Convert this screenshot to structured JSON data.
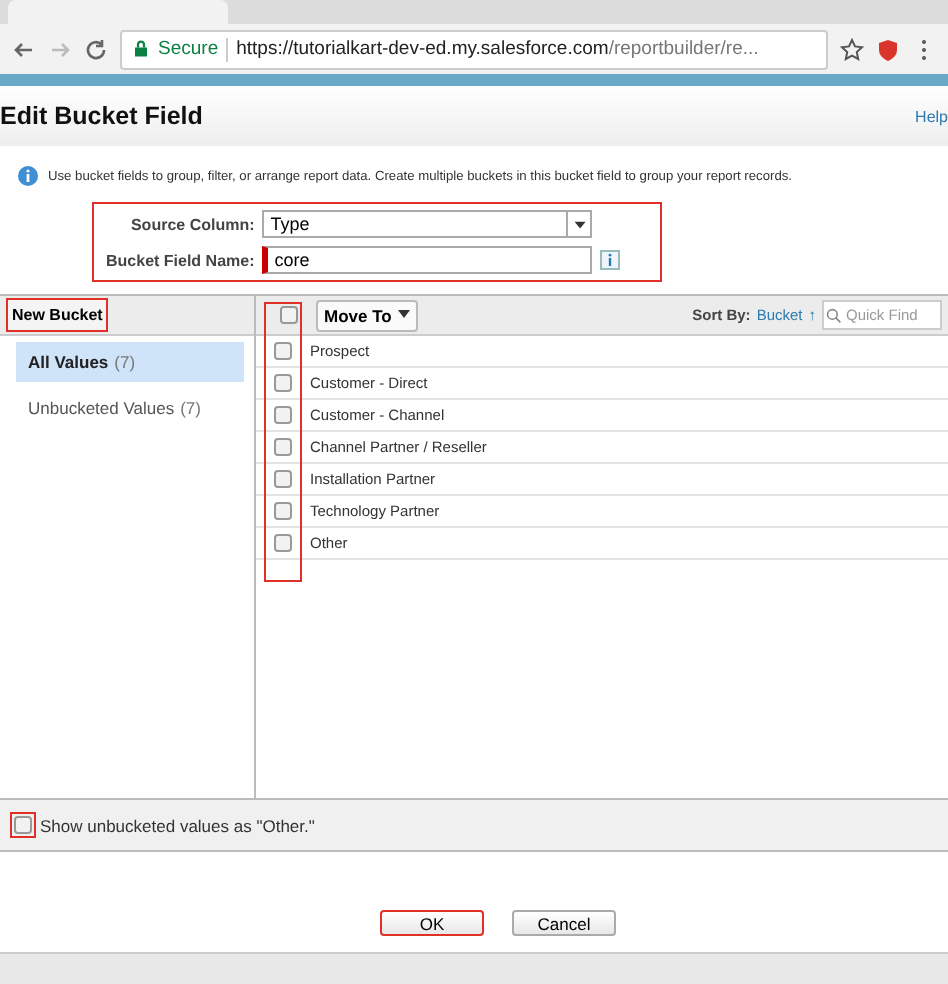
{
  "browser": {
    "secure_label": "Secure",
    "url_host": "https://tutorialkart-dev-ed.my.salesforce.com",
    "url_path": "/reportbuilder/re..."
  },
  "dialog": {
    "title": "Edit Bucket Field",
    "help": "Help",
    "info": "Use bucket fields to group, filter, or arrange report data. Create multiple buckets in this bucket field to group your report records."
  },
  "form": {
    "source_label": "Source Column:",
    "source_value": "Type",
    "name_label": "Bucket Field Name:",
    "name_value": "core"
  },
  "left_panel": {
    "button": "New Bucket",
    "items": [
      {
        "label": "All Values",
        "count": "(7)",
        "selected": true
      },
      {
        "label": "Unbucketed Values",
        "count": "(7)",
        "selected": false
      }
    ]
  },
  "right_panel": {
    "move_to": "Move To",
    "sort_label": "Sort By:",
    "sort_value": "Bucket",
    "sort_arrow": "↑",
    "search_placeholder": "Quick Find",
    "select_all_checked": false,
    "values": [
      {
        "label": "Prospect",
        "checked": false
      },
      {
        "label": "Customer - Direct",
        "checked": false
      },
      {
        "label": "Customer - Channel",
        "checked": false
      },
      {
        "label": "Channel Partner / Reseller",
        "checked": false
      },
      {
        "label": "Installation Partner",
        "checked": false
      },
      {
        "label": "Technology Partner",
        "checked": false
      },
      {
        "label": "Other",
        "checked": false
      }
    ]
  },
  "show_other": {
    "label": "Show unbucketed values as \"Other.\"",
    "checked": false
  },
  "buttons": [
    {
      "label": "OK",
      "highlighted": true
    },
    {
      "label": "Cancel",
      "highlighted": false
    }
  ]
}
